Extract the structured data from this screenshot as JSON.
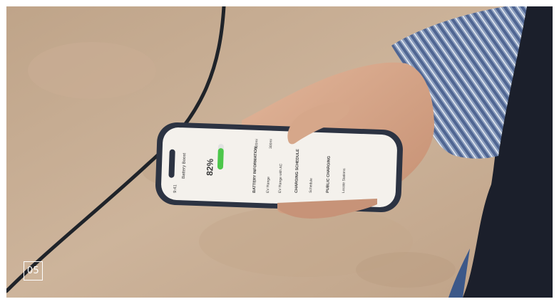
{
  "photo": {
    "description_icons": [
      "phone-icon",
      "hand-icon",
      "cable-icon"
    ]
  },
  "badge": {
    "label": "05"
  },
  "colors": {
    "ground": "#c7ad94",
    "phone_frame": "#2c3342",
    "screen": "#f4f1ec",
    "battery_green": "#4cc74a",
    "badge_border": "#ffffff"
  },
  "phone_screen": {
    "time": "9:41",
    "title": "Battery Boost",
    "charge_percent": "82%",
    "battery_level": 0.82,
    "range_top": "320mi",
    "range_bottom": "300mi",
    "section_battery": "BATTERY INFORMATION",
    "row_range": "EV Range",
    "row_range_ac": "EV Range with AC",
    "section_schedule": "CHARGING SCHEDULE",
    "row_schedule": "Schedule",
    "section_public": "PUBLIC CHARGING",
    "row_stations": "Locate Stations"
  }
}
